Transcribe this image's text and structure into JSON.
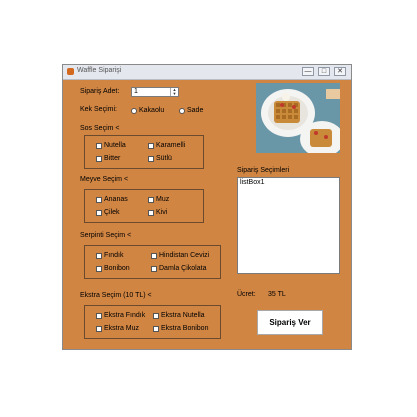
{
  "window": {
    "title": "Waffle Siparişi",
    "btn_min": "—",
    "btn_max": "□",
    "btn_close": "✕"
  },
  "quantity": {
    "label": "Sipariş Adet:",
    "value": "1"
  },
  "cake": {
    "label": "Kek Seçimi:",
    "options": [
      "Kakaolu",
      "Sade"
    ]
  },
  "sauce": {
    "label": "Sos Seçim <",
    "options": [
      "Nutella",
      "Karamelli",
      "Bitter",
      "Sütlü"
    ]
  },
  "fruit": {
    "label": "Meyve Seçim <",
    "options": [
      "Ananas",
      "Muz",
      "Çilek",
      "Kivi"
    ]
  },
  "sprinkle": {
    "label": "Serpinti Seçim <",
    "options": [
      "Fındık",
      "Hindistan Cevizi",
      "Bonibon",
      "Damla Çikolata"
    ]
  },
  "extra": {
    "label": "Ekstra Seçim (10 TL) <",
    "options": [
      "Ekstra Fındık",
      "Ekstra Nutella",
      "Ekstra Muz",
      "Ekstra Bonibon"
    ]
  },
  "selections": {
    "label": "Sipariş Seçimleri",
    "listbox_text": "listBox1"
  },
  "price": {
    "label": "Ücret:",
    "value": "35 TL"
  },
  "order_button": "Sipariş Ver"
}
